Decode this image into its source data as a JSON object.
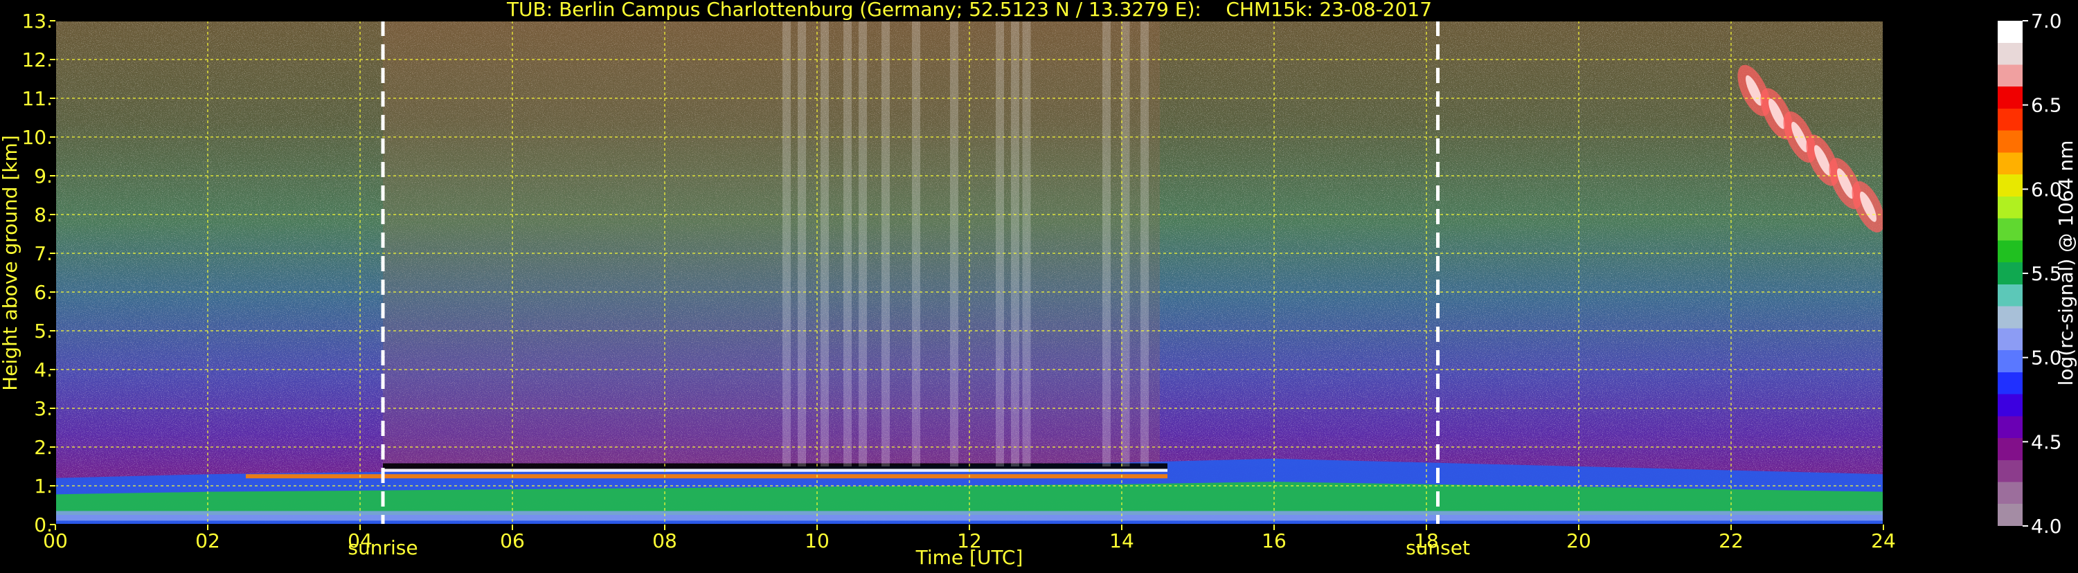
{
  "chart_data": {
    "type": "heatmap",
    "title": "TUB: Berlin Campus Charlottenburg (Germany; 52.5123 N / 13.3279 E):    CHM15k: 23-08-2017",
    "xlabel": "Time [UTC]",
    "ylabel": "Height above ground [km]",
    "colorbar_label": "log(rc-signal) @ 1064 nm",
    "xlim": [
      0,
      24
    ],
    "ylim": [
      0,
      13
    ],
    "x_ticks": [
      0,
      2,
      4,
      6,
      8,
      10,
      12,
      14,
      16,
      18,
      20,
      22,
      24
    ],
    "x_tick_labels": [
      "00",
      "02",
      "04",
      "06",
      "08",
      "10",
      "12",
      "14",
      "16",
      "18",
      "20",
      "22",
      "24"
    ],
    "y_ticks": [
      0,
      1,
      2,
      3,
      4,
      5,
      6,
      7,
      8,
      9,
      10,
      11,
      12,
      13
    ],
    "y_tick_labels": [
      "0.",
      "1.",
      "2.",
      "3.",
      "4.",
      "5.",
      "6.",
      "7.",
      "8.",
      "9.",
      "10.",
      "11.",
      "12.",
      "13."
    ],
    "grid": true,
    "colorbar": {
      "min": 4.0,
      "max": 7.0,
      "ticks": [
        4.0,
        4.5,
        5.0,
        5.5,
        6.0,
        6.5,
        7.0
      ],
      "tick_labels": [
        "4.0",
        "4.5",
        "5.0",
        "5.5",
        "6.0",
        "6.5",
        "7.0"
      ],
      "colors": [
        "#a48ca4",
        "#9c6e9c",
        "#8c3c8c",
        "#82108a",
        "#6a00b4",
        "#3c00e0",
        "#2030ff",
        "#5a78ff",
        "#8c9cf4",
        "#a8c0d8",
        "#5cc8b8",
        "#10a850",
        "#20c020",
        "#60d830",
        "#b0f020",
        "#e8e800",
        "#ffb000",
        "#ff7000",
        "#ff3000",
        "#f00000",
        "#f0a0a0",
        "#e8d8d8",
        "#ffffff"
      ]
    },
    "events": [
      {
        "label": "sunrise",
        "time": 4.3
      },
      {
        "label": "sunset",
        "time": 18.15
      }
    ],
    "layers": {
      "boundary_layer_top_km": [
        1.2,
        1.3,
        1.35,
        1.4,
        1.45,
        1.5,
        1.55,
        1.6,
        1.7,
        1.6,
        1.5,
        1.4,
        1.3
      ],
      "cloud_streaks_hours": [
        9.6,
        9.8,
        10.1,
        10.4,
        10.6,
        10.9,
        11.3,
        11.8,
        12.4,
        12.6,
        12.75,
        13.8,
        14.05,
        14.3
      ],
      "high_cloud_hours": [
        22.3,
        23.8
      ],
      "high_cloud_km": [
        8.2,
        11.2
      ]
    }
  }
}
